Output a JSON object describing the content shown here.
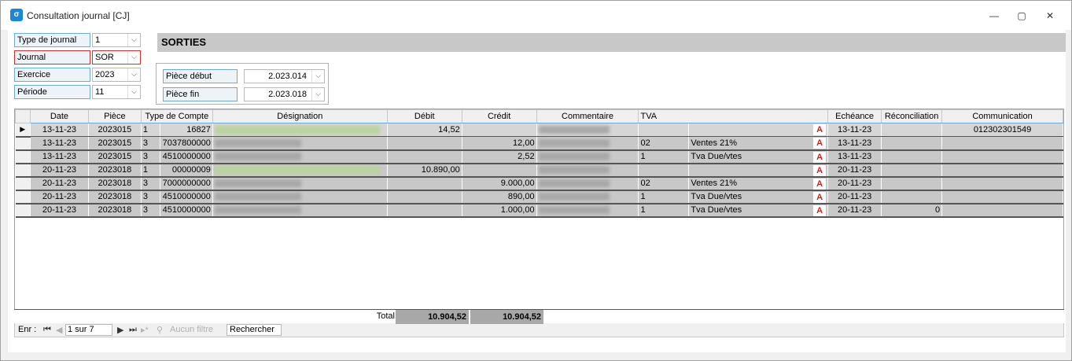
{
  "window": {
    "title": "Consultation journal [CJ]",
    "controls": {
      "minimize": "—",
      "maximize": "▢",
      "close": "✕"
    }
  },
  "form": {
    "type_journal": {
      "label": "Type de journal",
      "value": "1"
    },
    "journal": {
      "label": "Journal",
      "value": "SOR"
    },
    "exercice": {
      "label": "Exercice",
      "value": "2023"
    },
    "periode": {
      "label": "Période",
      "value": "11"
    },
    "journal_name": "SORTIES",
    "piece_debut": {
      "label": "Pièce début",
      "value": "2.023.014"
    },
    "piece_fin": {
      "label": "Pièce fin",
      "value": "2.023.018"
    }
  },
  "grid": {
    "columns": [
      "Date",
      "Pièce",
      "Type de Compte",
      "Désignation",
      "Débit",
      "Crédit",
      "Commentaire",
      "TVA",
      "Echéance",
      "Réconciliation",
      "Communication"
    ],
    "rows": [
      {
        "date": "13-11-23",
        "piece": "2023015",
        "type": "1",
        "compte": "16827",
        "designation_color": "green",
        "debit": "14,52",
        "credit": "",
        "tva_code": "",
        "tva_label": "",
        "echeance": "13-11-23",
        "reconciliation": "",
        "communication": "012302301549",
        "selected": true
      },
      {
        "date": "13-11-23",
        "piece": "2023015",
        "type": "3",
        "compte": "7037800000",
        "designation_color": "gray",
        "debit": "",
        "credit": "12,00",
        "tva_code": "02",
        "tva_label": "Ventes 21%",
        "echeance": "13-11-23",
        "reconciliation": "",
        "communication": ""
      },
      {
        "date": "13-11-23",
        "piece": "2023015",
        "type": "3",
        "compte": "4510000000",
        "designation_color": "gray",
        "debit": "",
        "credit": "2,52",
        "tva_code": "1",
        "tva_label": "Tva Due/vtes",
        "echeance": "13-11-23",
        "reconciliation": "",
        "communication": ""
      },
      {
        "date": "20-11-23",
        "piece": "2023018",
        "type": "1",
        "compte": "00000009",
        "designation_color": "green",
        "debit": "10.890,00",
        "credit": "",
        "tva_code": "",
        "tva_label": "",
        "echeance": "20-11-23",
        "reconciliation": "",
        "communication": ""
      },
      {
        "date": "20-11-23",
        "piece": "2023018",
        "type": "3",
        "compte": "7000000000",
        "designation_color": "gray",
        "debit": "",
        "credit": "9.000,00",
        "tva_code": "02",
        "tva_label": "Ventes 21%",
        "echeance": "20-11-23",
        "reconciliation": "",
        "communication": ""
      },
      {
        "date": "20-11-23",
        "piece": "2023018",
        "type": "3",
        "compte": "4510000000",
        "designation_color": "gray",
        "debit": "",
        "credit": "890,00",
        "tva_code": "1",
        "tva_label": "Tva Due/vtes",
        "echeance": "20-11-23",
        "reconciliation": "",
        "communication": ""
      },
      {
        "date": "20-11-23",
        "piece": "2023018",
        "type": "3",
        "compte": "4510000000",
        "designation_color": "gray",
        "debit": "",
        "credit": "1.000,00",
        "tva_code": "1",
        "tva_label": "Tva Due/vtes",
        "echeance": "20-11-23",
        "reconciliation": "0",
        "communication": ""
      }
    ],
    "tva_icon": "A",
    "total_label": "Total",
    "total_debit": "10.904,52",
    "total_credit": "10.904,52"
  },
  "navigator": {
    "prefix": "Enr :",
    "record": "1 sur 7",
    "filter": "Aucun filtre",
    "search": "Rechercher",
    "first_icon": "first-record-icon",
    "prev_icon": "previous-record-icon",
    "next_icon": "next-record-icon",
    "last_icon": "last-record-icon",
    "filter_icon": "filter-off-icon"
  },
  "colors": {
    "accent": "#1b87d4",
    "row_bg": "#c8c8c8",
    "total_bg": "#a8a8a8",
    "warning_red": "#d02020"
  }
}
